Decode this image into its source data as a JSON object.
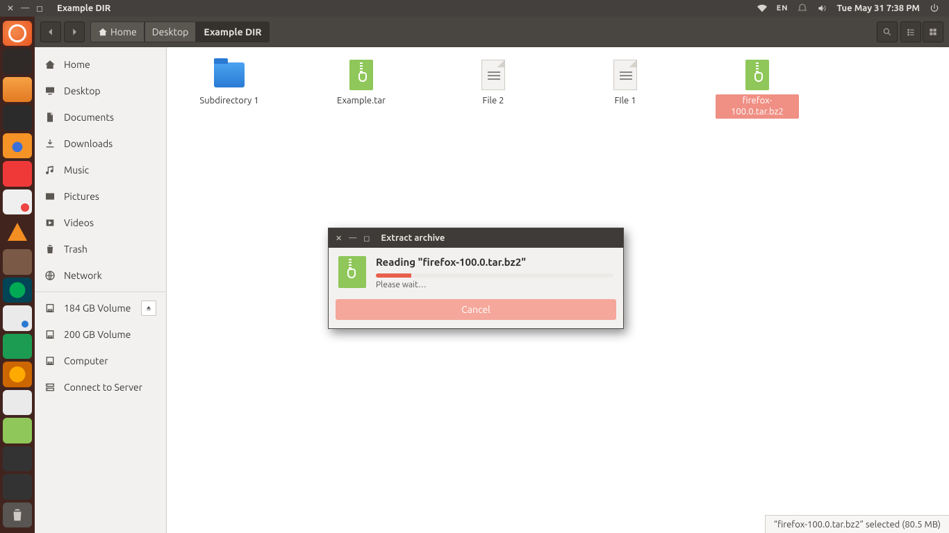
{
  "menubar": {
    "title": "Example DIR",
    "lang": "EN",
    "datetime": "Tue May 31  7:38 PM"
  },
  "toolbar": {
    "breadcrumb": [
      {
        "label": "Home",
        "hasHomeIcon": true
      },
      {
        "label": "Desktop"
      },
      {
        "label": "Example DIR",
        "active": true
      }
    ]
  },
  "sidebar": {
    "places": [
      {
        "icon": "home",
        "label": "Home"
      },
      {
        "icon": "desktop",
        "label": "Desktop"
      },
      {
        "icon": "doc",
        "label": "Documents"
      },
      {
        "icon": "download",
        "label": "Downloads"
      },
      {
        "icon": "music",
        "label": "Music"
      },
      {
        "icon": "pictures",
        "label": "Pictures"
      },
      {
        "icon": "videos",
        "label": "Videos"
      },
      {
        "icon": "trash",
        "label": "Trash"
      },
      {
        "icon": "network",
        "label": "Network"
      }
    ],
    "devices": [
      {
        "icon": "disk",
        "label": "184 GB Volume",
        "eject": true
      },
      {
        "icon": "disk",
        "label": "200 GB Volume"
      },
      {
        "icon": "disk",
        "label": "Computer"
      },
      {
        "icon": "server",
        "label": "Connect to Server"
      }
    ]
  },
  "files": [
    {
      "type": "folder",
      "label": "Subdirectory 1"
    },
    {
      "type": "archive",
      "label": "Example.tar"
    },
    {
      "type": "text",
      "label": "File 2"
    },
    {
      "type": "text",
      "label": "FIle 1"
    },
    {
      "type": "archive",
      "label": "firefox-100.0.tar.bz2",
      "selected": true
    }
  ],
  "status": {
    "text": "“firefox-100.0.tar.bz2” selected  (80.5 MB)"
  },
  "dialog": {
    "title": "Extract archive",
    "heading": "Reading \"firefox-100.0.tar.bz2\"",
    "note": "Please wait…",
    "progress_percent": 15,
    "cancel": "Cancel"
  }
}
